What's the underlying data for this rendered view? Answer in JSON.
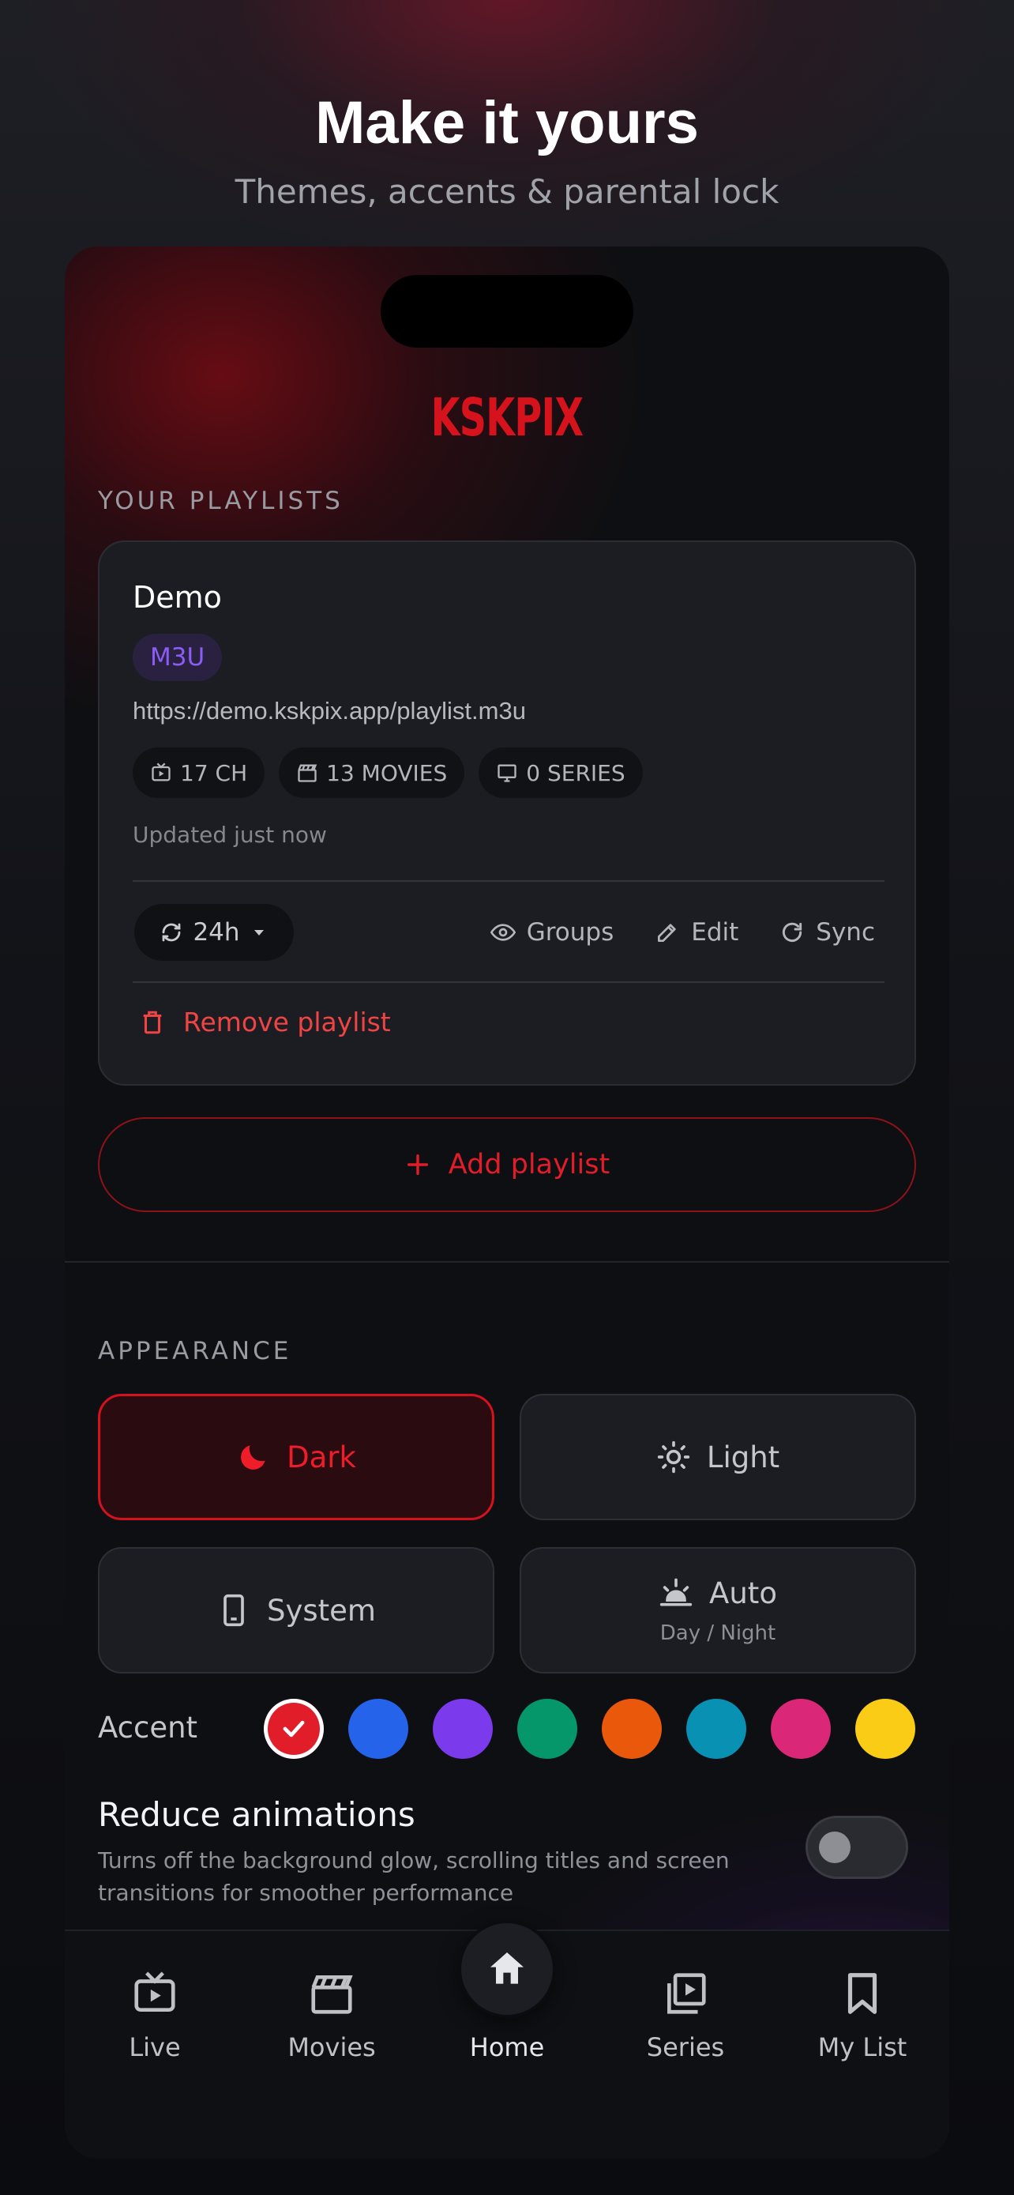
{
  "hero": {
    "title": "Make it yours",
    "subtitle": "Themes, accents & parental lock"
  },
  "app": {
    "logo": "KSKPIX",
    "brand_color": "#d6131d"
  },
  "playlists": {
    "section_label": "YOUR PLAYLISTS",
    "items": [
      {
        "name": "Demo",
        "type_badge": "M3U",
        "url": "https://demo.kskpix.app/playlist.m3u",
        "stats": [
          {
            "icon": "live-tv-icon",
            "label": "17 CH"
          },
          {
            "icon": "clapperboard-icon",
            "label": "13 MOVIES"
          },
          {
            "icon": "monitor-icon",
            "label": "0 SERIES"
          }
        ],
        "updated": "Updated just now",
        "sync_interval": "24h",
        "actions": {
          "groups": "Groups",
          "edit": "Edit",
          "sync": "Sync"
        },
        "remove_label": "Remove playlist"
      }
    ],
    "add_label": "Add playlist"
  },
  "appearance": {
    "section_label": "APPEARANCE",
    "themes": [
      {
        "id": "dark",
        "label": "Dark",
        "icon": "moon-icon",
        "active": true
      },
      {
        "id": "light",
        "label": "Light",
        "icon": "sun-icon",
        "active": false
      },
      {
        "id": "system",
        "label": "System",
        "icon": "phone-icon",
        "active": false
      },
      {
        "id": "auto",
        "label": "Auto",
        "sub": "Day / Night",
        "icon": "sunrise-icon",
        "active": false
      }
    ],
    "accent_label": "Accent",
    "accents": [
      "#e11d2a",
      "#2563eb",
      "#7c3aed",
      "#059669",
      "#ea580c",
      "#0891b2",
      "#db2777",
      "#facc15"
    ],
    "selected_accent": "#e11d2a",
    "reduce_animations": {
      "title": "Reduce animations",
      "description": "Turns off the background glow, scrolling titles and screen transitions for smoother performance",
      "enabled": false
    }
  },
  "navigation": {
    "items": [
      {
        "id": "live",
        "label": "Live",
        "icon": "live-tv-icon"
      },
      {
        "id": "movies",
        "label": "Movies",
        "icon": "clapperboard-icon"
      },
      {
        "id": "home",
        "label": "Home",
        "icon": "home-icon",
        "active": true
      },
      {
        "id": "series",
        "label": "Series",
        "icon": "series-icon"
      },
      {
        "id": "mylist",
        "label": "My List",
        "icon": "bookmark-icon"
      }
    ]
  }
}
